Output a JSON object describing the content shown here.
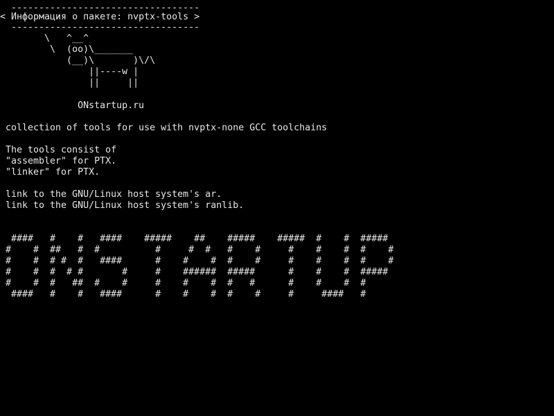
{
  "screen": {
    "background": "#000000",
    "foreground": "#e8e8e8"
  },
  "cowsay": {
    "bubble_top": " ----------------------------------",
    "bubble_text": "< Информация о пакете: nvptx-tools >",
    "bubble_bottom": " ----------------------------------",
    "cow_line_1": "       \\   ^__^",
    "cow_line_2": "        \\  (oo)\\_______",
    "cow_line_3": "           (__)\\       )\\/\\",
    "cow_line_4": "               ||----w |",
    "cow_line_5": "               ||     ||"
  },
  "site": {
    "name": "             ONstartup.ru"
  },
  "description": {
    "summary": "collection of tools for use with nvptx-none GCC toolchains",
    "intro": "The tools consist of",
    "item_1": "\"assembler\" for PTX.",
    "item_2": "\"linker\" for PTX.",
    "link_1": "link to the GNU/Linux host system's ar.",
    "link_2": "link to the GNU/Linux host system's ranlib."
  },
  "banner": {
    "row_1": " ####   #    #   ####    #####    ##    #####    #####  #    #  #####",
    "row_2": "#    #  ##   #  #          #     #  #   #    #     #    #    #  #    #",
    "row_3": "#    #  # #  #   ####      #    #    #  #    #     #    #    #  #    #",
    "row_4": "#    #  #  # #       #     #    ######  #####      #    #    #  #####",
    "row_5": "#    #  #   ##  #    #     #    #    #  #   #      #    #    #  #",
    "row_6": " ####   #    #   ####      #    #    #  #    #     #     ####   #"
  }
}
